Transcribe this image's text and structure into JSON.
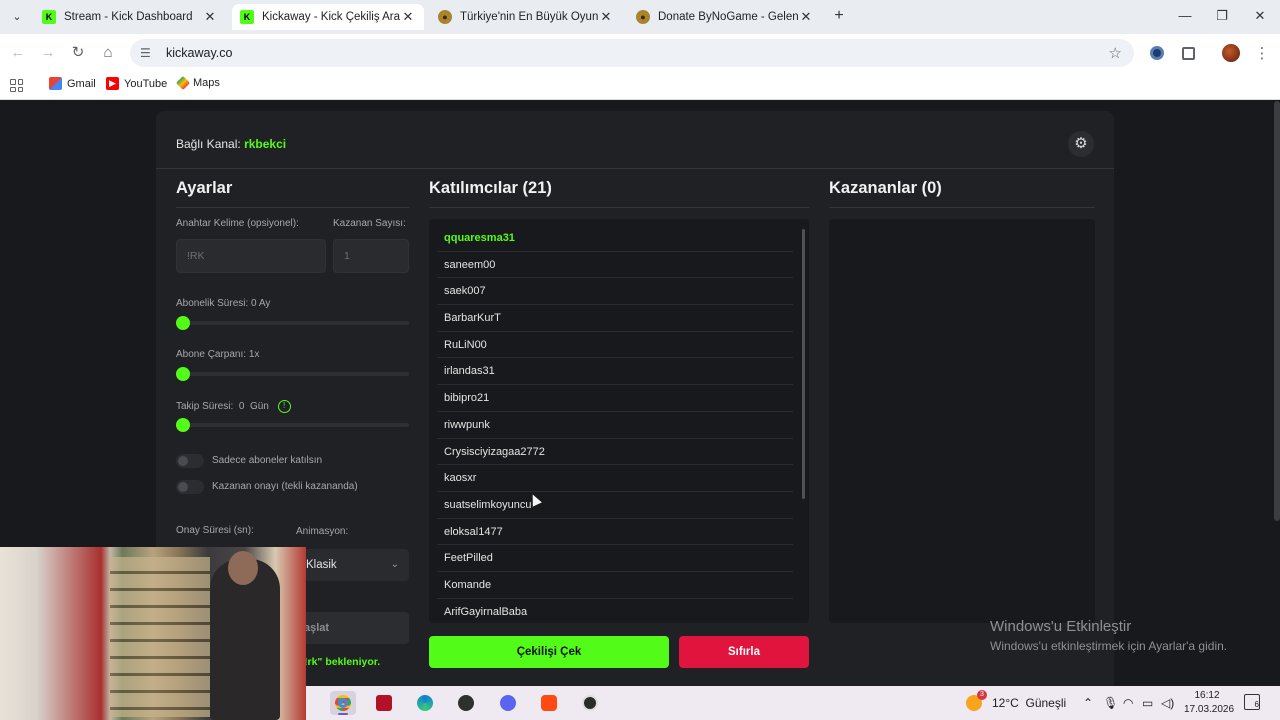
{
  "browser": {
    "tabs": [
      {
        "title": "Stream - Kick Dashboard",
        "favicon": "kick-icon",
        "active": false
      },
      {
        "title": "Kickaway - Kick Çekiliş Aracı",
        "favicon": "kick-icon",
        "active": true
      },
      {
        "title": "Türkiye'nin En Büyük Oyuncu D",
        "favicon": "bynogame-icon",
        "active": false
      },
      {
        "title": "Donate ByNoGame - Gelen/Gid",
        "favicon": "bynogame-icon",
        "active": false
      }
    ],
    "url": "kickaway.co",
    "bookmarks": [
      {
        "label": "Gmail",
        "icon": "gmail-icon"
      },
      {
        "label": "YouTube",
        "icon": "youtube-icon"
      },
      {
        "label": "Maps",
        "icon": "maps-icon"
      }
    ]
  },
  "header": {
    "channel_label": "Bağlı Kanal:",
    "channel_name": "rkbekci"
  },
  "settings": {
    "title": "Ayarlar",
    "keyword_label": "Anahtar Kelime (opsiyonel):",
    "keyword_placeholder": "!RK",
    "winner_count_label": "Kazanan Sayısı:",
    "winner_count_placeholder": "1",
    "sub_duration_label": "Abonelik Süresi: 0 Ay",
    "sub_duration_value": 0,
    "sub_multiplier_label": "Abone Çarpanı: 1x",
    "sub_multiplier_value": 1,
    "follow_label": "Takip Süresi:",
    "follow_value": "0",
    "follow_unit": "Gün",
    "toggle_subs_only": "Sadece aboneler katılsın",
    "toggle_winner_confirm": "Kazanan onayı (tekli kazananda)",
    "confirm_time_label": "Onay Süresi (sn):",
    "animation_label": "Animasyon:",
    "animation_value": "Klasik",
    "start_button_partial": "aşlat",
    "waiting_partial": "!rk\" bekleniyor."
  },
  "participants": {
    "title": "Katılımcılar (21)",
    "items": [
      "qquaresma31",
      "saneem00",
      "saek007",
      "BarbarKurT",
      "RuLiN00",
      "irlandas31",
      "bibipro21",
      "riwwpunk",
      "Crysisciyizagaa2772",
      "kaosxr",
      "suatselimkoyuncu",
      "eloksal1477",
      "FeetPilled",
      "Komande",
      "ArifGayirnalBaba"
    ]
  },
  "winners": {
    "title": "Kazananlar (0)"
  },
  "actions": {
    "draw_label": "Çekilişi Çek",
    "reset_label": "Sıfırla"
  },
  "watermark": {
    "line1": "Windows'u Etkinleştir",
    "line2": "Windows'u etkinleştirmek için Ayarlar'a gidin."
  },
  "taskbar": {
    "weather_temp": "12°C",
    "weather_text": "Güneşli",
    "weather_badge": "3",
    "time": "16:12",
    "date": "17.03.2026",
    "notification_count": "6"
  },
  "colors": {
    "accent": "#53fc18",
    "danger": "#e0143c",
    "background": "#18191c",
    "card": "#202124"
  }
}
